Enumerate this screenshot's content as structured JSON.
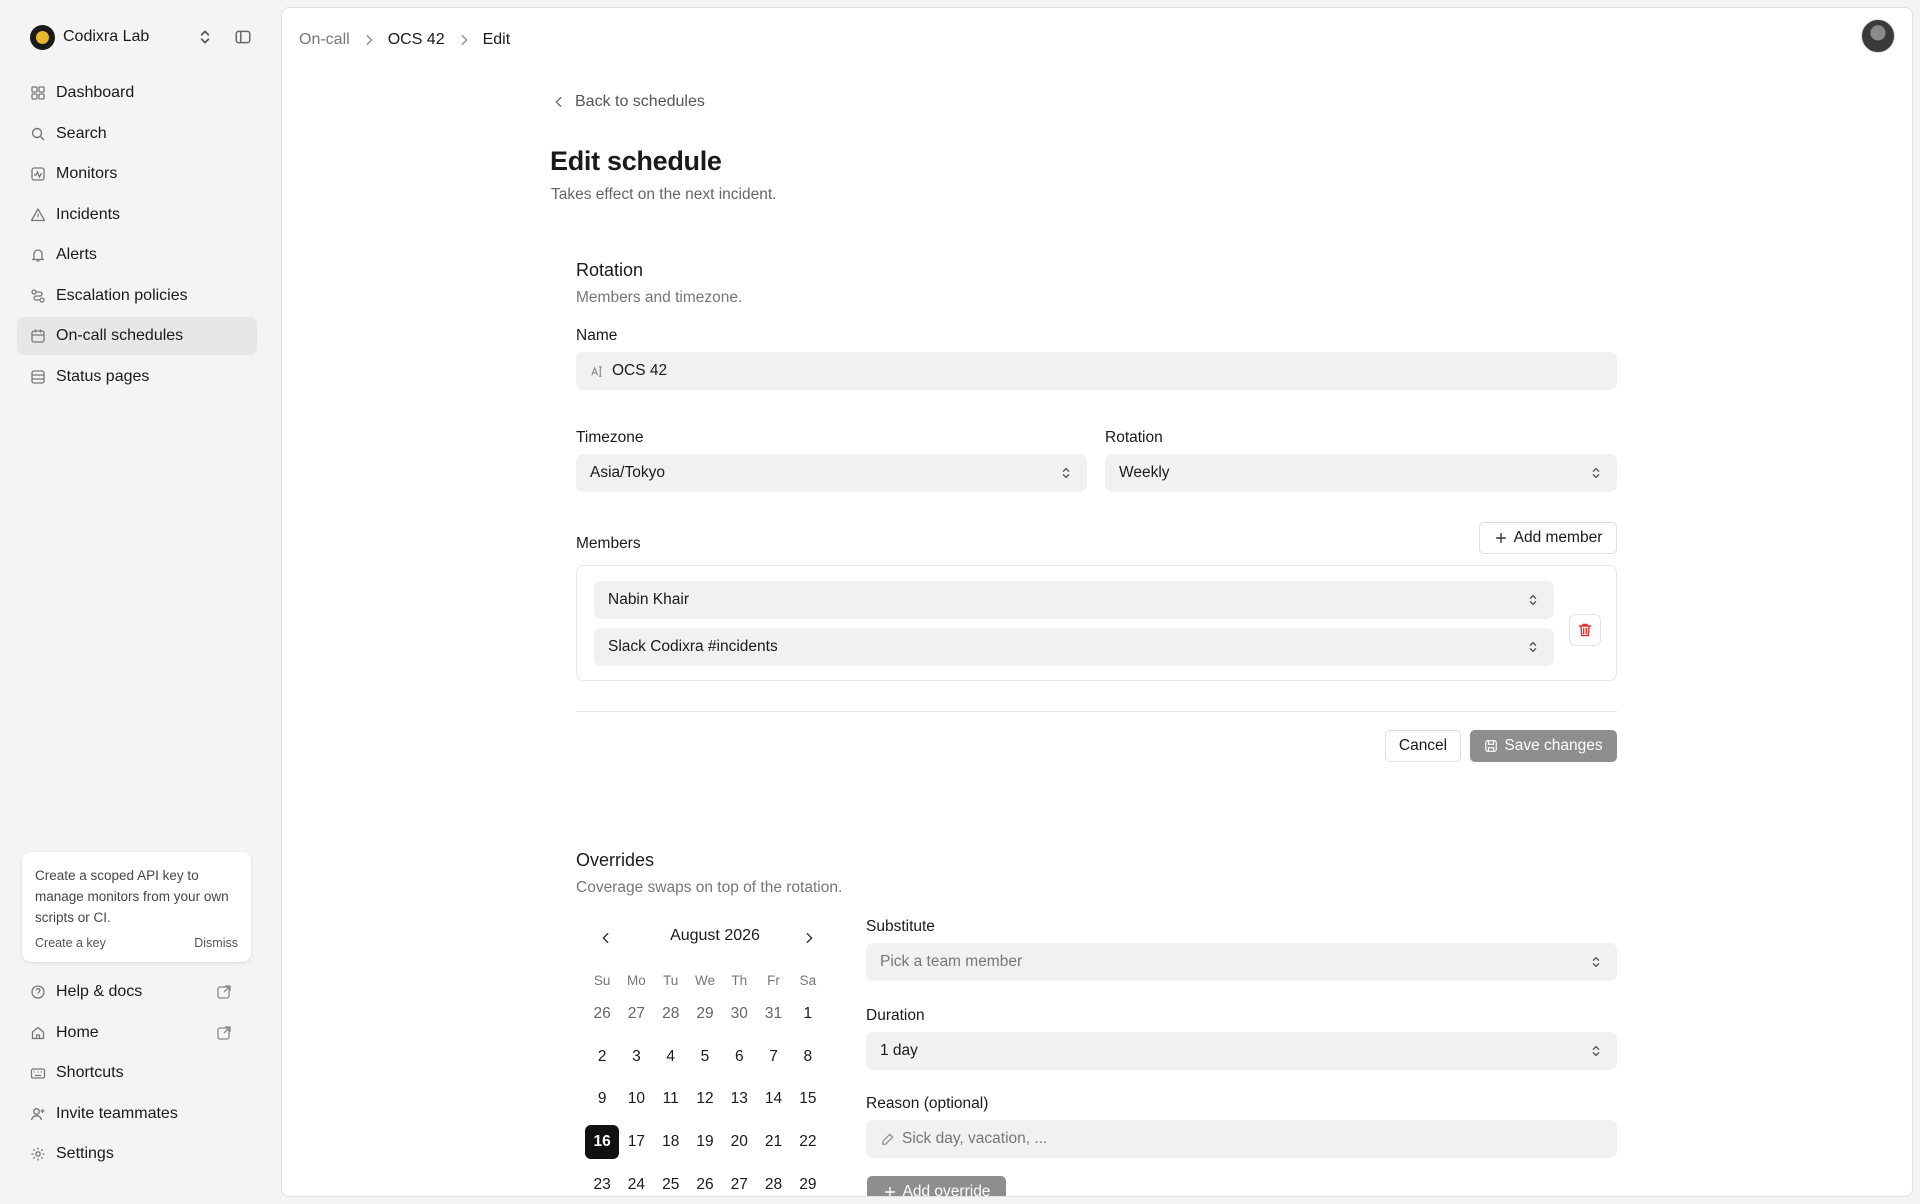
{
  "workspace": {
    "name": "Codixra Lab"
  },
  "nav": [
    {
      "label": "Dashboard",
      "icon": "dashboard-icon"
    },
    {
      "label": "Search",
      "icon": "search-icon"
    },
    {
      "label": "Monitors",
      "icon": "monitor-icon"
    },
    {
      "label": "Incidents",
      "icon": "warning-icon"
    },
    {
      "label": "Alerts",
      "icon": "bell-icon"
    },
    {
      "label": "Escalation policies",
      "icon": "escalation-icon"
    },
    {
      "label": "On-call schedules",
      "icon": "calendar-icon"
    },
    {
      "label": "Status pages",
      "icon": "status-page-icon"
    }
  ],
  "promo": {
    "text": "Create a scoped API key to manage monitors from your own scripts or CI.",
    "action": "Create a key",
    "dismiss": "Dismiss"
  },
  "bottom_nav": [
    {
      "label": "Help & docs"
    },
    {
      "label": "Home"
    },
    {
      "label": "Shortcuts"
    },
    {
      "label": "Invite teammates"
    },
    {
      "label": "Settings"
    }
  ],
  "breadcrumb": [
    "On-call",
    "OCS 42",
    "Edit"
  ],
  "back_link": "Back to schedules",
  "page": {
    "title": "Edit schedule",
    "subtitle": "Takes effect on the next incident."
  },
  "rotation_section": {
    "title": "Rotation",
    "subtitle": "Members and timezone.",
    "name_label": "Name",
    "name_value": "OCS 42",
    "timezone_label": "Timezone",
    "timezone_value": "Asia/Tokyo",
    "rotation_label": "Rotation",
    "rotation_value": "Weekly",
    "members_label": "Members",
    "add_member": "Add member",
    "member_name": "Nabin Khair",
    "member_channel": "Slack Codixra #incidents",
    "cancel": "Cancel",
    "save": "Save changes"
  },
  "overrides": {
    "title": "Overrides",
    "subtitle": "Coverage swaps on top of the rotation.",
    "calendar_month": "August 2026",
    "weekdays": [
      "Su",
      "Mo",
      "Tu",
      "We",
      "Th",
      "Fr",
      "Sa"
    ],
    "weeks": [
      [
        "26",
        "27",
        "28",
        "29",
        "30",
        "31",
        "1"
      ],
      [
        "2",
        "3",
        "4",
        "5",
        "6",
        "7",
        "8"
      ],
      [
        "9",
        "10",
        "11",
        "12",
        "13",
        "14",
        "15"
      ],
      [
        "16",
        "17",
        "18",
        "19",
        "20",
        "21",
        "22"
      ],
      [
        "23",
        "24",
        "25",
        "26",
        "27",
        "28",
        "29"
      ]
    ],
    "selected_day": "16",
    "substitute_label": "Substitute",
    "substitute_placeholder": "Pick a team member",
    "duration_label": "Duration",
    "duration_value": "1 day",
    "reason_label": "Reason (optional)",
    "reason_placeholder": "Sick day, vacation, ...",
    "add_override": "Add override"
  },
  "colors": {
    "accent": "#111111",
    "primary_disabled": "#8e8e8e",
    "danger": "#e03131",
    "brand_logo": "#e8b72c"
  }
}
